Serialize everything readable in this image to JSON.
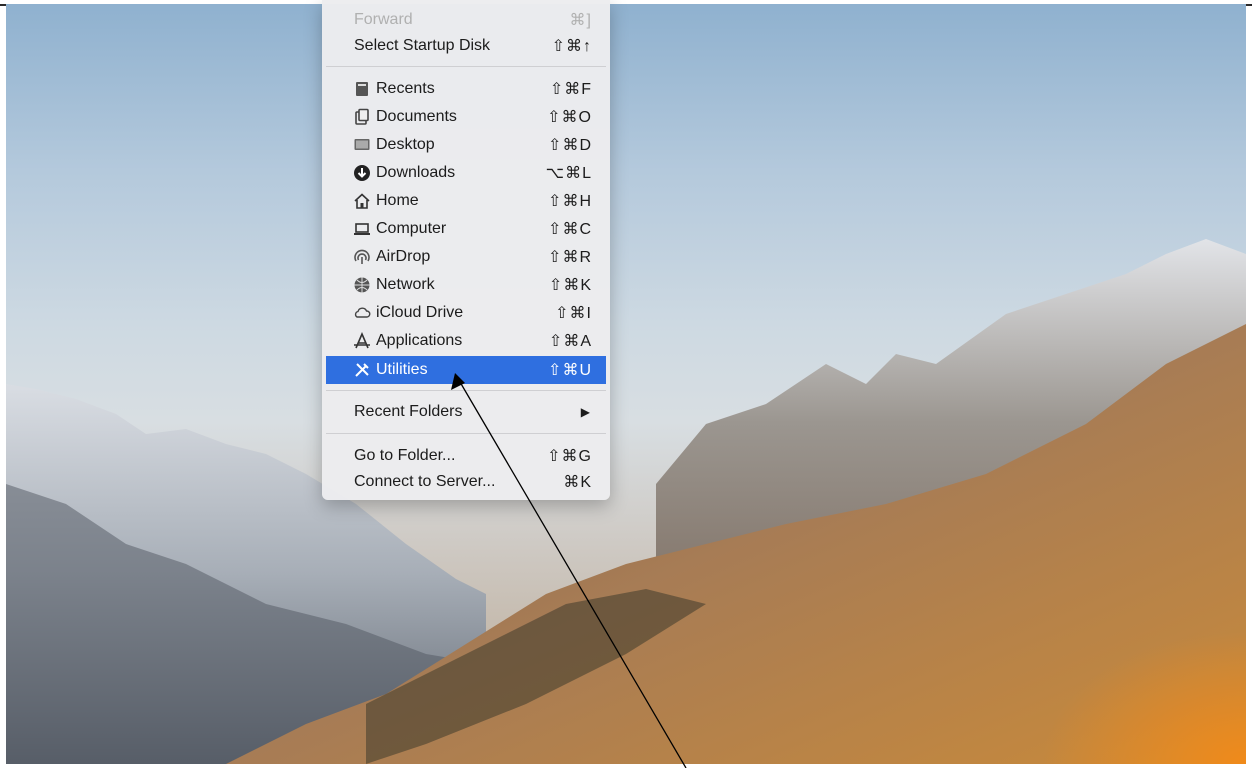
{
  "menu": {
    "items_top": [
      {
        "label": "Forward",
        "shortcut": "⌘]",
        "state": "disabled"
      },
      {
        "label": "Select Startup Disk",
        "shortcut": "⇧⌘↑"
      }
    ],
    "items_places": [
      {
        "label": "Recents",
        "shortcut": "⇧⌘F",
        "icon": "recents-icon"
      },
      {
        "label": "Documents",
        "shortcut": "⇧⌘O",
        "icon": "documents-icon"
      },
      {
        "label": "Desktop",
        "shortcut": "⇧⌘D",
        "icon": "desktop-icon"
      },
      {
        "label": "Downloads",
        "shortcut": "⌥⌘L",
        "icon": "downloads-icon"
      },
      {
        "label": "Home",
        "shortcut": "⇧⌘H",
        "icon": "home-icon"
      },
      {
        "label": "Computer",
        "shortcut": "⇧⌘C",
        "icon": "computer-icon"
      },
      {
        "label": "AirDrop",
        "shortcut": "⇧⌘R",
        "icon": "airdrop-icon"
      },
      {
        "label": "Network",
        "shortcut": "⇧⌘K",
        "icon": "network-icon"
      },
      {
        "label": "iCloud Drive",
        "shortcut": "⇧⌘I",
        "icon": "icloud-icon"
      },
      {
        "label": "Applications",
        "shortcut": "⇧⌘A",
        "icon": "applications-icon"
      },
      {
        "label": "Utilities",
        "shortcut": "⇧⌘U",
        "icon": "utilities-icon",
        "state": "selected"
      }
    ],
    "recent_folders": {
      "label": "Recent Folders",
      "submenu_indicator": "▶"
    },
    "items_bottom": [
      {
        "label": "Go to Folder...",
        "shortcut": "⇧⌘G"
      },
      {
        "label": "Connect to Server...",
        "shortcut": "⌘K"
      }
    ],
    "colors": {
      "selected_bg": "#2f6fe0",
      "menu_bg": "#ececee",
      "disabled_text": "#b0b0b0"
    }
  },
  "annotation": {
    "type": "arrow",
    "color": "#000000",
    "points_to": "Utilities"
  }
}
